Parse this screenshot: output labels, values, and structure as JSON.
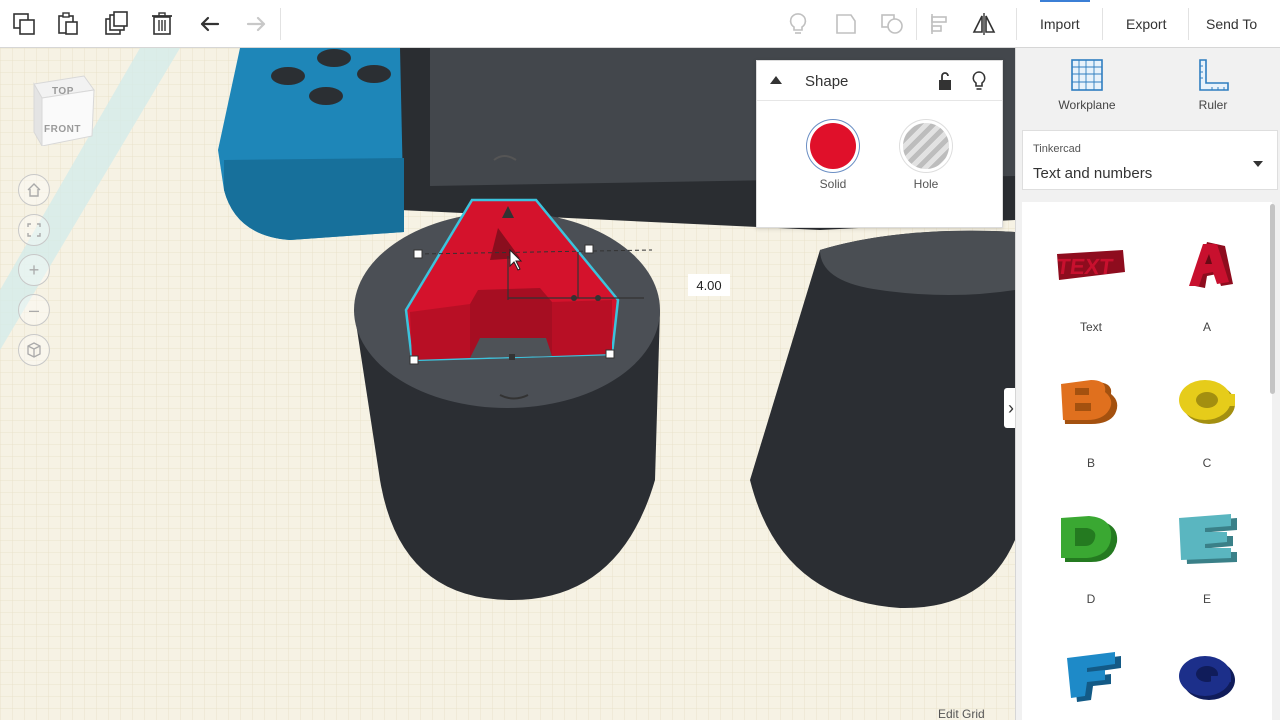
{
  "toolbar": {
    "import_label": "Import",
    "export_label": "Export",
    "send_to_label": "Send To"
  },
  "view_cube": {
    "top_label": "TOP",
    "front_label": "FRONT"
  },
  "inspector": {
    "title": "Shape",
    "solid_label": "Solid",
    "hole_label": "Hole",
    "solid_color": "#e0102a"
  },
  "dimension_value": "4.00",
  "edit_grid_label": "Edit Grid",
  "right_panel": {
    "workplane_label": "Workplane",
    "ruler_label": "Ruler",
    "library_source": "Tinkercad",
    "library_name": "Text and numbers",
    "shapes": [
      {
        "label": "Text",
        "color": "#c8102e"
      },
      {
        "label": "A",
        "color": "#c8102e"
      },
      {
        "label": "B",
        "color": "#e0701e"
      },
      {
        "label": "C",
        "color": "#e6cc1a"
      },
      {
        "label": "D",
        "color": "#3aa832"
      },
      {
        "label": "E",
        "color": "#5ab6c0"
      },
      {
        "label": "",
        "color": "#1e8ac8"
      },
      {
        "label": "",
        "color": "#1c2f8a"
      }
    ]
  }
}
